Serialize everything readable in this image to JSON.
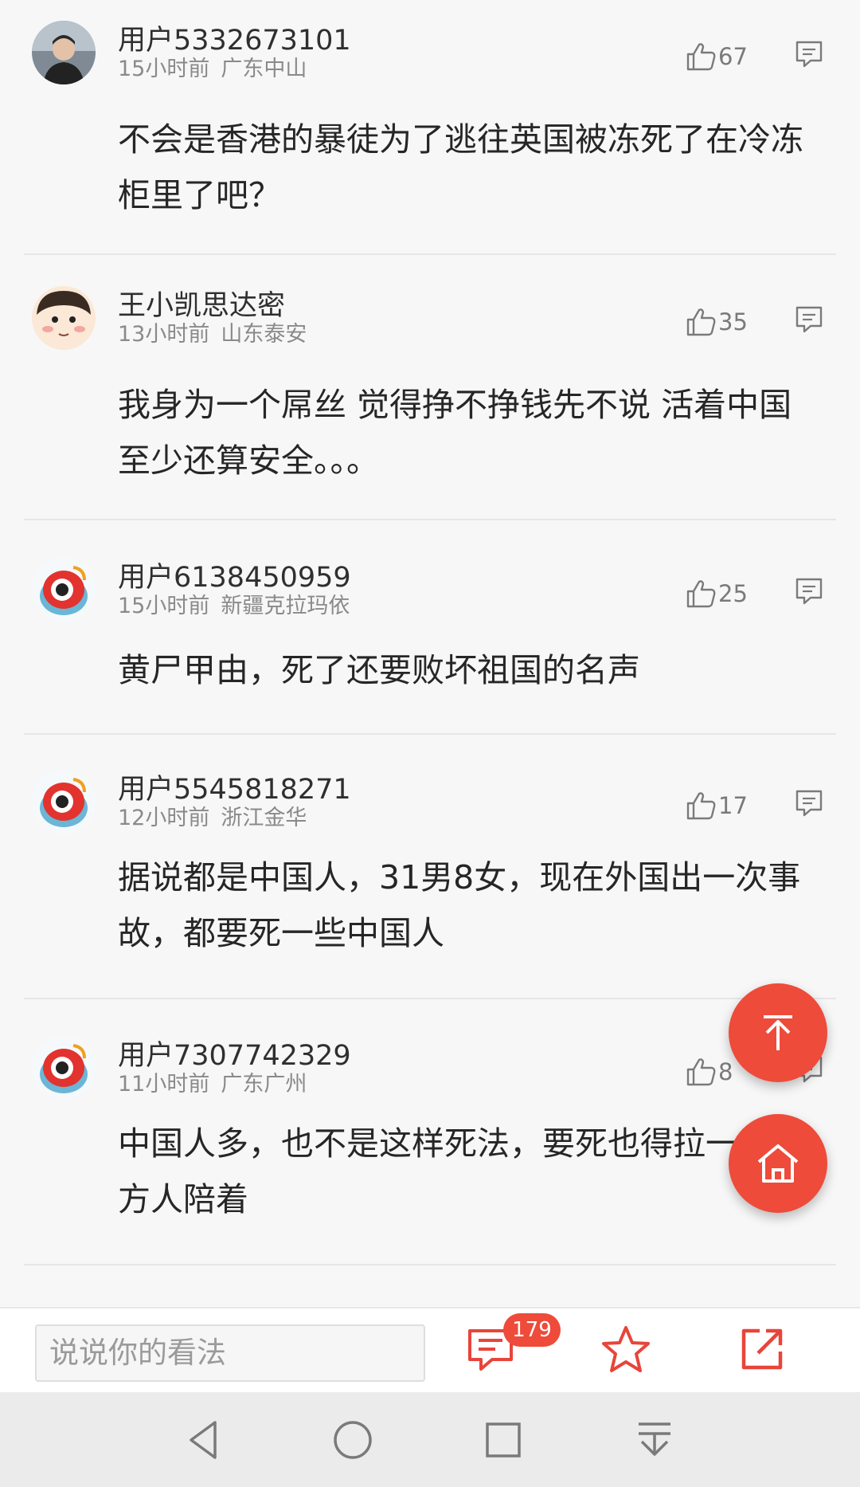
{
  "comments": [
    {
      "username": "用户5332673101",
      "time": "15小时前",
      "location": "广东中山",
      "likes": "67",
      "text": "不会是香港的暴徒为了逃往英国被冻死了在冷冻柜里了吧？",
      "avatar": "user-photo-avatar"
    },
    {
      "username": "王小凯思达密",
      "time": "13小时前",
      "location": "山东泰安",
      "likes": "35",
      "text": "我身为一个屌丝 觉得挣不挣钱先不说 活着中国至少还算安全。。。",
      "avatar": "cartoon-face-avatar"
    },
    {
      "username": "用户6138450959",
      "time": "15小时前",
      "location": "新疆克拉玛依",
      "likes": "25",
      "text": "黄尸甲由，死了还要败坏祖国的名声",
      "avatar": "weibo-logo-avatar"
    },
    {
      "username": "用户5545818271",
      "time": "12小时前",
      "location": "浙江金华",
      "likes": "17",
      "text": "据说都是中国人，31男8女，现在外国出一次事故，都要死一些中国人",
      "avatar": "weibo-logo-avatar"
    },
    {
      "username": "用户7307742329",
      "time": "11小时前",
      "location": "广东广州",
      "likes": "8",
      "text": "中国人多，也不是这样死法，要死也得拉一些西方人陪着",
      "avatar": "weibo-logo-avatar"
    }
  ],
  "bottom_bar": {
    "input_placeholder": "说说你的看法",
    "comment_count": "179"
  },
  "colors": {
    "accent": "#ee4b3a",
    "text": "#262626",
    "meta": "#8a8a8a"
  },
  "icons": [
    "thumbs-up-icon",
    "reply-icon",
    "back-to-top-icon",
    "home-icon",
    "comments-icon",
    "star-icon",
    "share-icon",
    "nav-back-icon",
    "nav-home-icon",
    "nav-recents-icon",
    "nav-down-icon"
  ]
}
